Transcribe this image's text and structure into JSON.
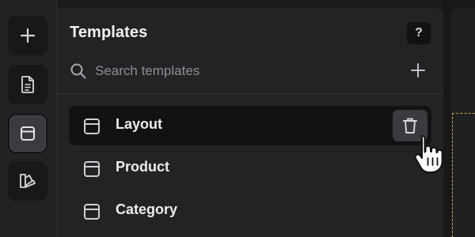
{
  "rail": {
    "items": [
      {
        "name": "add",
        "icon": "plus-icon",
        "active": false
      },
      {
        "name": "pages",
        "icon": "document-icon",
        "active": false
      },
      {
        "name": "templates",
        "icon": "layout-icon",
        "active": true
      },
      {
        "name": "styles",
        "icon": "swatches-icon",
        "active": false
      }
    ]
  },
  "templates_panel": {
    "title": "Templates",
    "help_label": "?",
    "search": {
      "placeholder": "Search templates",
      "value": ""
    },
    "items": [
      {
        "label": "Layout",
        "selected": true
      },
      {
        "label": "Product",
        "selected": false
      },
      {
        "label": "Category",
        "selected": false
      }
    ]
  },
  "colors": {
    "panel_bg": "#232326",
    "rail_bg": "#222225",
    "selected_item_bg": "#121214",
    "canvas_frame_dashed": "#c8a43a"
  }
}
